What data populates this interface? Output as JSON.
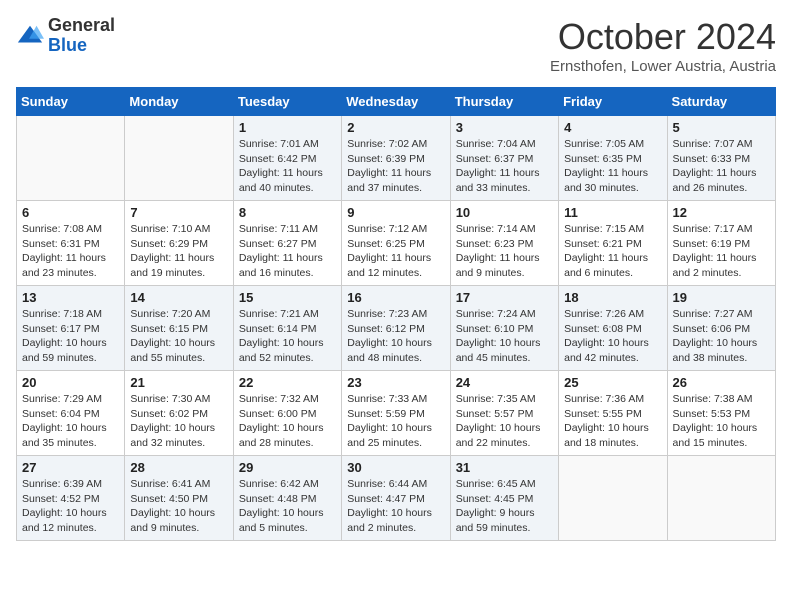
{
  "header": {
    "logo_line1": "General",
    "logo_line2": "Blue",
    "month": "October 2024",
    "location": "Ernsthofen, Lower Austria, Austria"
  },
  "weekdays": [
    "Sunday",
    "Monday",
    "Tuesday",
    "Wednesday",
    "Thursday",
    "Friday",
    "Saturday"
  ],
  "weeks": [
    [
      {
        "day": "",
        "info": ""
      },
      {
        "day": "",
        "info": ""
      },
      {
        "day": "1",
        "info": "Sunrise: 7:01 AM\nSunset: 6:42 PM\nDaylight: 11 hours and 40 minutes."
      },
      {
        "day": "2",
        "info": "Sunrise: 7:02 AM\nSunset: 6:39 PM\nDaylight: 11 hours and 37 minutes."
      },
      {
        "day": "3",
        "info": "Sunrise: 7:04 AM\nSunset: 6:37 PM\nDaylight: 11 hours and 33 minutes."
      },
      {
        "day": "4",
        "info": "Sunrise: 7:05 AM\nSunset: 6:35 PM\nDaylight: 11 hours and 30 minutes."
      },
      {
        "day": "5",
        "info": "Sunrise: 7:07 AM\nSunset: 6:33 PM\nDaylight: 11 hours and 26 minutes."
      }
    ],
    [
      {
        "day": "6",
        "info": "Sunrise: 7:08 AM\nSunset: 6:31 PM\nDaylight: 11 hours and 23 minutes."
      },
      {
        "day": "7",
        "info": "Sunrise: 7:10 AM\nSunset: 6:29 PM\nDaylight: 11 hours and 19 minutes."
      },
      {
        "day": "8",
        "info": "Sunrise: 7:11 AM\nSunset: 6:27 PM\nDaylight: 11 hours and 16 minutes."
      },
      {
        "day": "9",
        "info": "Sunrise: 7:12 AM\nSunset: 6:25 PM\nDaylight: 11 hours and 12 minutes."
      },
      {
        "day": "10",
        "info": "Sunrise: 7:14 AM\nSunset: 6:23 PM\nDaylight: 11 hours and 9 minutes."
      },
      {
        "day": "11",
        "info": "Sunrise: 7:15 AM\nSunset: 6:21 PM\nDaylight: 11 hours and 6 minutes."
      },
      {
        "day": "12",
        "info": "Sunrise: 7:17 AM\nSunset: 6:19 PM\nDaylight: 11 hours and 2 minutes."
      }
    ],
    [
      {
        "day": "13",
        "info": "Sunrise: 7:18 AM\nSunset: 6:17 PM\nDaylight: 10 hours and 59 minutes."
      },
      {
        "day": "14",
        "info": "Sunrise: 7:20 AM\nSunset: 6:15 PM\nDaylight: 10 hours and 55 minutes."
      },
      {
        "day": "15",
        "info": "Sunrise: 7:21 AM\nSunset: 6:14 PM\nDaylight: 10 hours and 52 minutes."
      },
      {
        "day": "16",
        "info": "Sunrise: 7:23 AM\nSunset: 6:12 PM\nDaylight: 10 hours and 48 minutes."
      },
      {
        "day": "17",
        "info": "Sunrise: 7:24 AM\nSunset: 6:10 PM\nDaylight: 10 hours and 45 minutes."
      },
      {
        "day": "18",
        "info": "Sunrise: 7:26 AM\nSunset: 6:08 PM\nDaylight: 10 hours and 42 minutes."
      },
      {
        "day": "19",
        "info": "Sunrise: 7:27 AM\nSunset: 6:06 PM\nDaylight: 10 hours and 38 minutes."
      }
    ],
    [
      {
        "day": "20",
        "info": "Sunrise: 7:29 AM\nSunset: 6:04 PM\nDaylight: 10 hours and 35 minutes."
      },
      {
        "day": "21",
        "info": "Sunrise: 7:30 AM\nSunset: 6:02 PM\nDaylight: 10 hours and 32 minutes."
      },
      {
        "day": "22",
        "info": "Sunrise: 7:32 AM\nSunset: 6:00 PM\nDaylight: 10 hours and 28 minutes."
      },
      {
        "day": "23",
        "info": "Sunrise: 7:33 AM\nSunset: 5:59 PM\nDaylight: 10 hours and 25 minutes."
      },
      {
        "day": "24",
        "info": "Sunrise: 7:35 AM\nSunset: 5:57 PM\nDaylight: 10 hours and 22 minutes."
      },
      {
        "day": "25",
        "info": "Sunrise: 7:36 AM\nSunset: 5:55 PM\nDaylight: 10 hours and 18 minutes."
      },
      {
        "day": "26",
        "info": "Sunrise: 7:38 AM\nSunset: 5:53 PM\nDaylight: 10 hours and 15 minutes."
      }
    ],
    [
      {
        "day": "27",
        "info": "Sunrise: 6:39 AM\nSunset: 4:52 PM\nDaylight: 10 hours and 12 minutes."
      },
      {
        "day": "28",
        "info": "Sunrise: 6:41 AM\nSunset: 4:50 PM\nDaylight: 10 hours and 9 minutes."
      },
      {
        "day": "29",
        "info": "Sunrise: 6:42 AM\nSunset: 4:48 PM\nDaylight: 10 hours and 5 minutes."
      },
      {
        "day": "30",
        "info": "Sunrise: 6:44 AM\nSunset: 4:47 PM\nDaylight: 10 hours and 2 minutes."
      },
      {
        "day": "31",
        "info": "Sunrise: 6:45 AM\nSunset: 4:45 PM\nDaylight: 9 hours and 59 minutes."
      },
      {
        "day": "",
        "info": ""
      },
      {
        "day": "",
        "info": ""
      }
    ]
  ]
}
